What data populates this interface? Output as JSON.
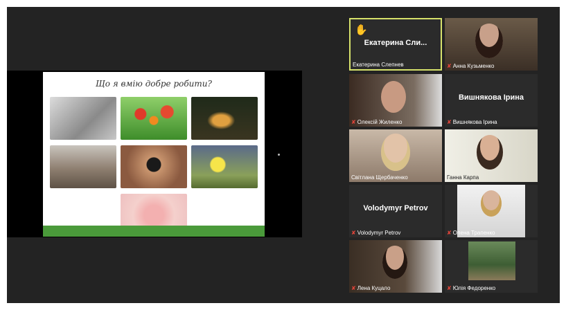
{
  "slide": {
    "title": "Що я вмію добре робити?"
  },
  "participants": [
    {
      "id": "p1",
      "name": "Екатерина Сли...",
      "label": "Екатерина Слепнев",
      "video": false,
      "active": true,
      "hand_raised": true,
      "muted": false
    },
    {
      "id": "p2",
      "name": "",
      "label": "Анна Кузьменко",
      "video": true,
      "muted": true
    },
    {
      "id": "p3",
      "name": "",
      "label": "Олексій Жиленко",
      "video": true,
      "muted": true
    },
    {
      "id": "p4",
      "name": "Вишнякова Ірина",
      "label": "Вишнякова Ірина",
      "video": false,
      "muted": true
    },
    {
      "id": "p5",
      "name": "",
      "label": "Світлана Щербаченко",
      "video": true,
      "muted": false
    },
    {
      "id": "p6",
      "name": "",
      "label": "Ганна Карпа",
      "video": true,
      "muted": false
    },
    {
      "id": "p7",
      "name": "Volodymyr Petrov",
      "label": "Volodymyr Petrov",
      "video": false,
      "muted": true
    },
    {
      "id": "p8",
      "name": "",
      "label": "Олена Трапенко",
      "video": true,
      "muted": true
    },
    {
      "id": "p9",
      "name": "",
      "label": "Лена Куцало",
      "video": true,
      "muted": true
    },
    {
      "id": "p10",
      "name": "",
      "label": "Юлія Федоренко",
      "video": true,
      "muted": true
    }
  ],
  "icons": {
    "mic_muted": "mic-muted-icon",
    "hand": "raised-hand-icon"
  },
  "colors": {
    "active_border": "#d7e26b",
    "muted": "#e5453a",
    "slide_bar": "#4a9a3a"
  }
}
